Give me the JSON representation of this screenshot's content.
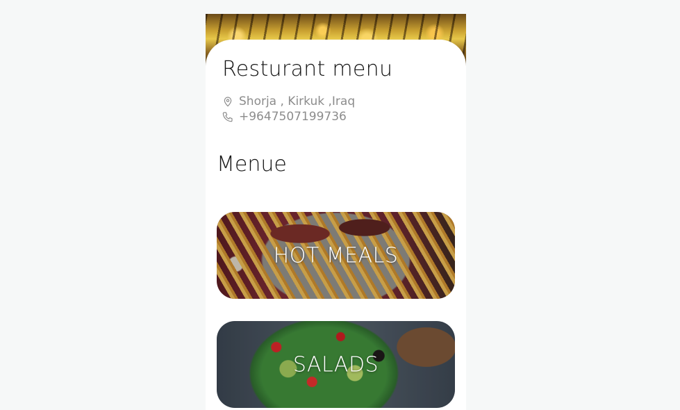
{
  "header": {
    "title": "Resturant menu",
    "location": "Shorja , Kirkuk ,Iraq",
    "phone": "+9647507199736"
  },
  "menu": {
    "section_title": "Menue",
    "categories": [
      {
        "label": "HOT MEALS",
        "image": "steak-and-fries-photo"
      },
      {
        "label": "SALADS",
        "image": "green-salad-bowl-photo"
      }
    ]
  },
  "icons": {
    "location": "location-pin-icon",
    "phone": "phone-icon"
  },
  "colors": {
    "page_background": "#f6f8f8",
    "card_background": "#ffffff",
    "title_text": "#141414",
    "secondary_text": "#8c8c8c",
    "card_label": "#ffffff"
  }
}
